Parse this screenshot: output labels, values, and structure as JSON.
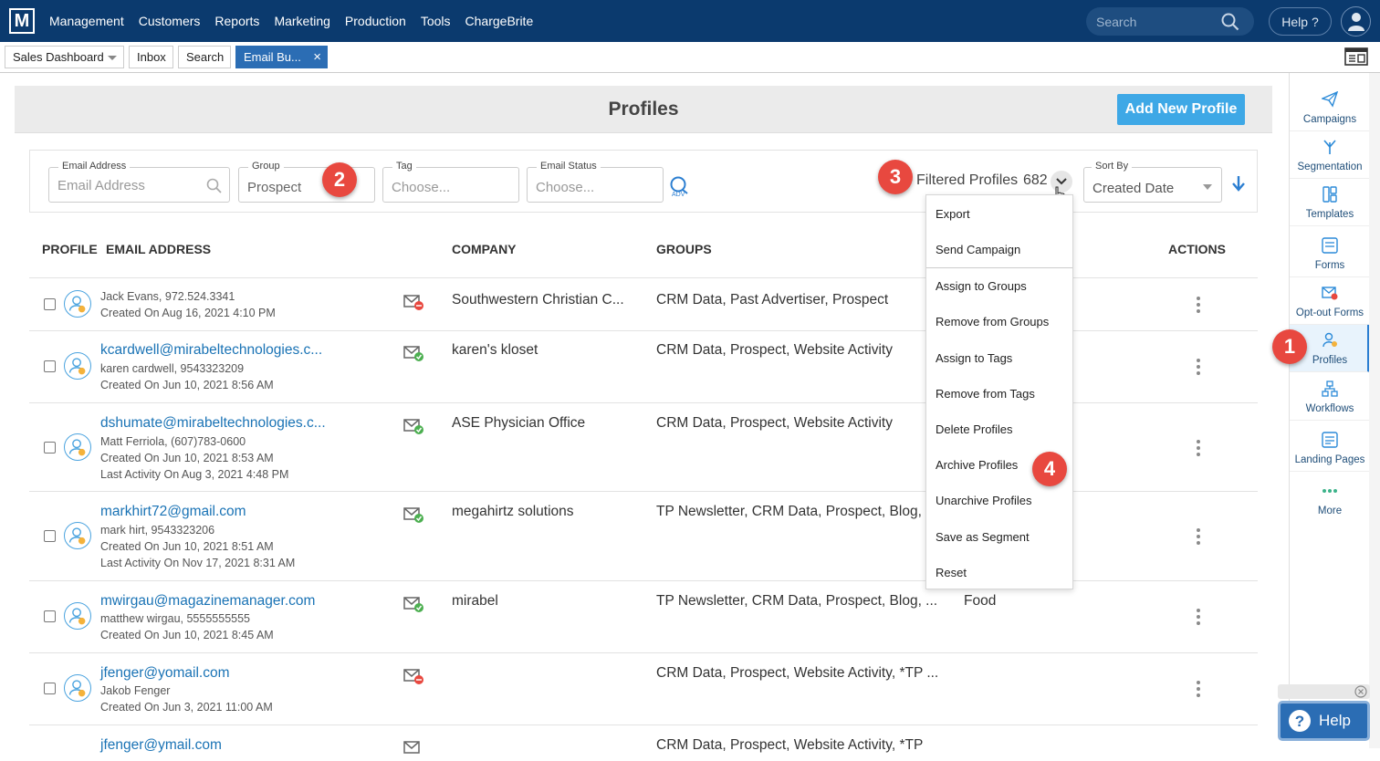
{
  "topbar": {
    "logo": "M",
    "nav": [
      "Management",
      "Customers",
      "Reports",
      "Marketing",
      "Production",
      "Tools",
      "ChargeBrite"
    ],
    "search_placeholder": "Search",
    "help_label": "Help ?"
  },
  "tabs": {
    "sales_dashboard": "Sales Dashboard",
    "inbox": "Inbox",
    "search": "Search",
    "email_builder": "Email Bu...",
    "close": "×"
  },
  "page": {
    "title": "Profiles",
    "add_button": "Add New Profile"
  },
  "filters": {
    "email_label": "Email Address",
    "email_placeholder": "Email Address",
    "group_label": "Group",
    "group_value": "Prospect",
    "tag_label": "Tag",
    "tag_placeholder": "Choose...",
    "status_label": "Email Status",
    "status_placeholder": "Choose...",
    "adv_label": "ADV",
    "filtered_label": "Filtered Profiles",
    "filtered_count": "682",
    "sort_label": "Sort By",
    "sort_value": "Created Date"
  },
  "table": {
    "headers": {
      "profile": "PROFILE",
      "email": "EMAIL ADDRESS",
      "company": "COMPANY",
      "groups": "GROUPS",
      "actions": "ACTIONS"
    },
    "rows": [
      {
        "email": "",
        "line1": "Jack Evans,  972.524.3341",
        "line2": "Created On Aug 16, 2021 4:10 PM",
        "line3": "",
        "company": "Southwestern Christian C...",
        "groups": "CRM Data, Past Advertiser, Prospect",
        "tags": "",
        "mail_status": "bounced"
      },
      {
        "email": "kcardwell@mirabeltechnologies.c...",
        "line1": "karen cardwell,  9543323209",
        "line2": "Created On Jun 10, 2021 8:56 AM",
        "line3": "",
        "company": "karen's kloset",
        "groups": "CRM Data, Prospect, Website Activity",
        "tags": "",
        "mail_status": "ok"
      },
      {
        "email": "dshumate@mirabeltechnologies.c...",
        "line1": "Matt Ferriola,  (607)783-0600",
        "line2": "Created On Jun 10, 2021 8:53 AM",
        "line3": "Last Activity On Aug 3, 2021 4:48 PM",
        "company": "ASE Physician Office",
        "groups": "CRM Data, Prospect, Website Activity",
        "tags": "",
        "mail_status": "ok"
      },
      {
        "email": "markhirt72@gmail.com",
        "line1": "mark hirt,  9543323206",
        "line2": "Created On Jun 10, 2021 8:51 AM",
        "line3": "Last Activity On Nov 17, 2021 8:31 AM",
        "company": "megahirtz solutions",
        "groups": "TP Newsletter, CRM Data, Prospect, Blog, ...",
        "tags": "",
        "mail_status": "ok"
      },
      {
        "email": "mwirgau@magazinemanager.com",
        "line1": "matthew wirgau,  5555555555",
        "line2": "Created On Jun 10, 2021 8:45 AM",
        "line3": "",
        "company": "mirabel",
        "groups": "TP Newsletter, CRM Data, Prospect, Blog, ...",
        "tags": "Food",
        "mail_status": "ok"
      },
      {
        "email": "jfenger@yomail.com",
        "line1": "Jakob Fenger",
        "line2": "Created On Jun 3, 2021 11:00 AM",
        "line3": "",
        "company": "",
        "groups": "CRM Data, Prospect, Website Activity, *TP ...",
        "tags": "",
        "mail_status": "bounced"
      },
      {
        "email": "jfenger@ymail.com",
        "line1": "",
        "line2": "",
        "line3": "",
        "company": "",
        "groups": "CRM Data, Prospect, Website Activity, *TP",
        "tags": "",
        "mail_status": "ok"
      }
    ]
  },
  "dropdown": [
    "Export",
    "Send Campaign",
    "Assign to Groups",
    "Remove from Groups",
    "Assign to Tags",
    "Remove from Tags",
    "Delete Profiles",
    "Archive Profiles",
    "Unarchive Profiles",
    "Save as Segment",
    "Reset"
  ],
  "sidebar": [
    "Campaigns",
    "Segmentation",
    "Templates",
    "Forms",
    "Opt-out Forms",
    "Profiles",
    "Workflows",
    "Landing Pages",
    "More"
  ],
  "help_float": "Help",
  "badges": [
    "1",
    "2",
    "3",
    "4"
  ],
  "colors": {
    "topbar": "#0b3a6e",
    "accent": "#2b6db4",
    "add_button": "#3ea8e6",
    "badge": "#e8483f",
    "link": "#1a73b5"
  }
}
